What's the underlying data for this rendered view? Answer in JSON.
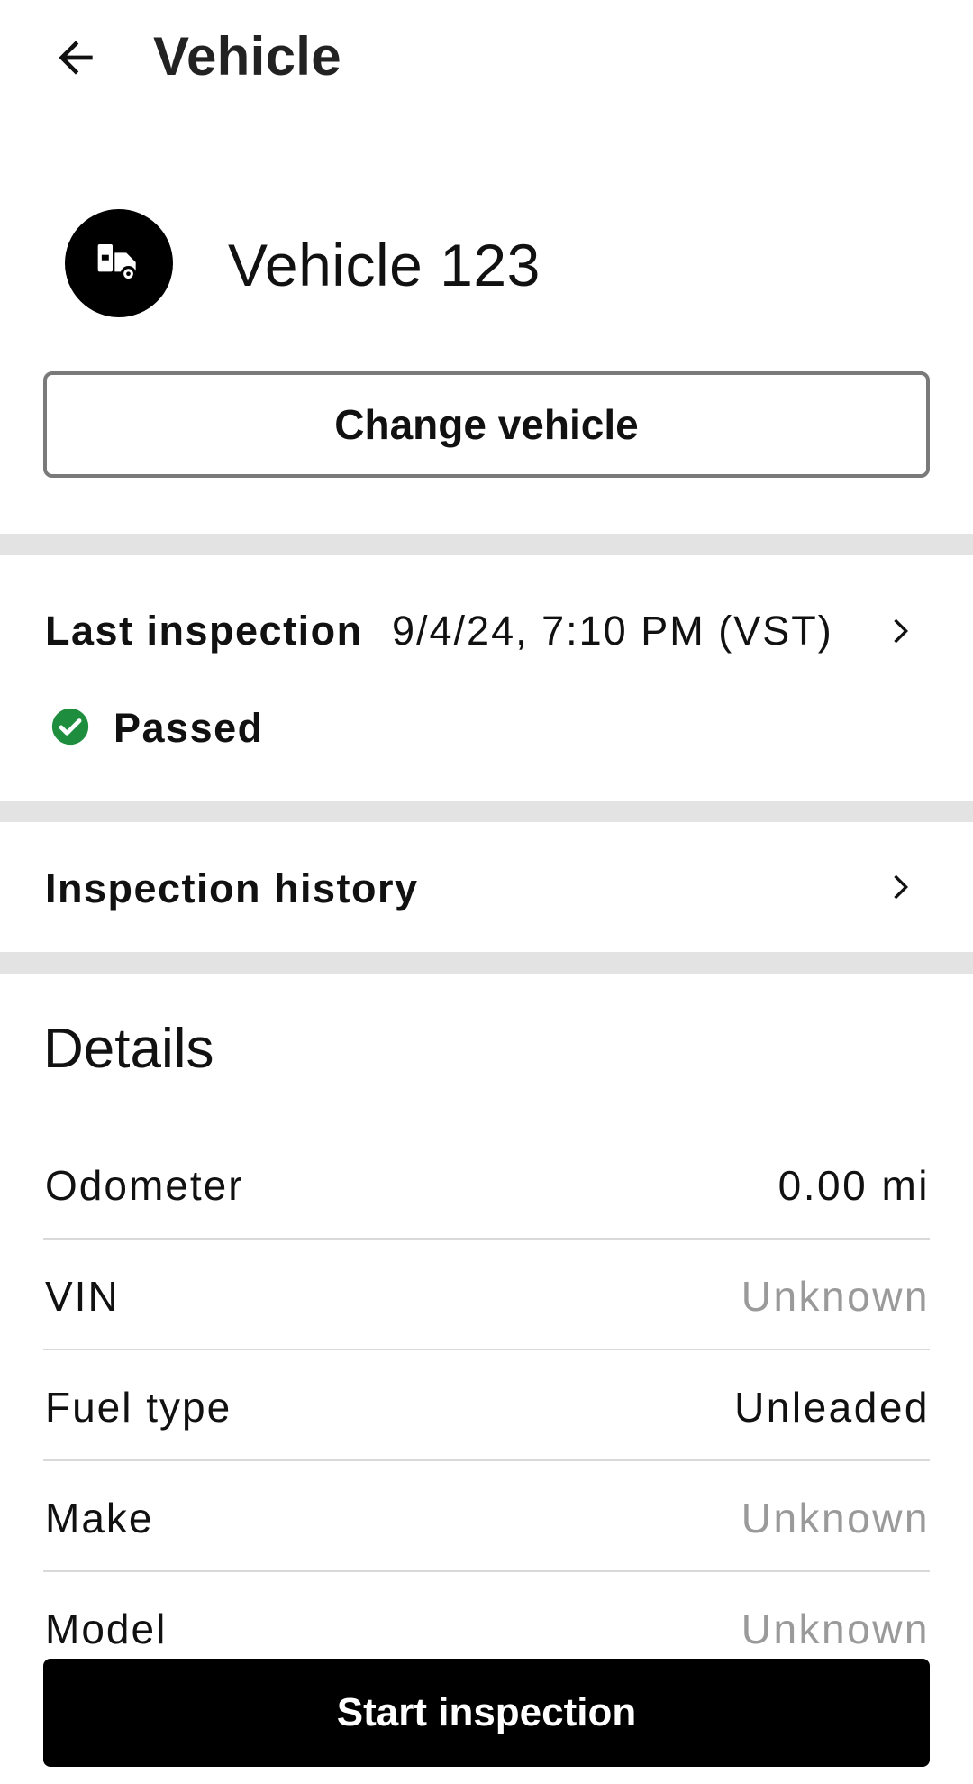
{
  "appbar": {
    "title": "Vehicle",
    "back_icon": "arrow-left-icon"
  },
  "vehicle": {
    "name": "Vehicle 123",
    "avatar_icon": "truck-icon",
    "change_label": "Change vehicle"
  },
  "last_inspection": {
    "label": "Last inspection",
    "datetime": "9/4/24, 7:10 PM (VST)",
    "status": "Passed",
    "status_icon": "check-circle-icon",
    "status_color": "#1e8e3e"
  },
  "history": {
    "label": "Inspection history"
  },
  "details": {
    "title": "Details",
    "rows": [
      {
        "label": "Odometer",
        "value": "0.00 mi"
      },
      {
        "label": "VIN",
        "value": "Unknown"
      },
      {
        "label": "Fuel type",
        "value": "Unleaded"
      },
      {
        "label": "Make",
        "value": "Unknown"
      },
      {
        "label": "Model",
        "value": "Unknown"
      }
    ]
  },
  "actions": {
    "start_label": "Start inspection"
  }
}
